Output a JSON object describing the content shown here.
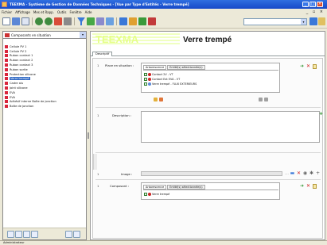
{
  "window": {
    "title": "TEEXMA - Système de Gestion de Données Techniques - [Vue par Type d'Entités - Verre trempé]",
    "controls": {
      "minimize": "_",
      "maximize": "□",
      "close": "×"
    },
    "colors": {
      "titlebar": "#1f5ad6",
      "close": "#d9482a"
    }
  },
  "menubar": {
    "items": [
      "Fichier",
      "Affichage",
      "Mes et Rapp.",
      "Outils",
      "Fenêtre",
      "Aide"
    ],
    "right_controls": "_ ▫ ×"
  },
  "toolbar": {
    "icons": [
      "new-icon",
      "save-icon",
      "print-icon",
      "back-icon",
      "forward-icon",
      "home-icon",
      "filter-icon",
      "text-icon",
      "chart-icon",
      "refresh-icon",
      "export-icon",
      "excel-icon",
      "delete-icon"
    ],
    "search_value": ""
  },
  "left_panel": {
    "combo_value": "Composants en situation",
    "items": [
      {
        "label": "Cellule PV 1",
        "selected": false
      },
      {
        "label": "Cellule PV 2",
        "selected": false
      },
      {
        "label": "Ruban contact 1",
        "selected": false
      },
      {
        "label": "Ruban contact 2",
        "selected": false
      },
      {
        "label": "Ruban contact 3",
        "selected": false
      },
      {
        "label": "Ruban sortie",
        "selected": false
      },
      {
        "label": "Protection silicone",
        "selected": false
      },
      {
        "label": "Verre trempé",
        "selected": true
      },
      {
        "label": "Cadre alu",
        "selected": false
      },
      {
        "label": "Joint silicone",
        "selected": false
      },
      {
        "label": "EVA",
        "selected": false
      },
      {
        "label": "EVA",
        "selected": false
      },
      {
        "label": "Adhésif interne Boîte de jonction",
        "selected": false
      },
      {
        "label": "Boîte de jonction",
        "selected": false
      }
    ],
    "bottom_icons": [
      "tree-view-icon",
      "list-view-icon",
      "search-view-icon",
      "sort-icon",
      "expand-icon",
      "collapse-icon"
    ]
  },
  "main": {
    "watermark": "TEEXMA",
    "page_title": "Verre trempé",
    "tab": "Descriptif",
    "fields": {
      "position": {
        "num": "1",
        "label": "Place en situation :",
        "colon": ":",
        "subtabs": [
          "Arborescence",
          "Entité(s) sélectionnée(s)"
        ],
        "tree": [
          {
            "label": "Contact 2V - VT"
          },
          {
            "label": "Contact Ext EVA - VT"
          },
          {
            "label": "Verre trempé - FLUX EXTERIEURS"
          }
        ]
      },
      "description": {
        "num": "1",
        "label": "Description :",
        "value": ""
      },
      "image": {
        "num": "1",
        "label": "Image :",
        "value": ""
      },
      "component": {
        "num": "1",
        "label": "Composant :",
        "subtabs": [
          "Arborescence",
          "Entité(s) sélectionnée(s)"
        ],
        "tree": [
          {
            "label": "Verre trempé"
          }
        ]
      }
    }
  },
  "statusbar": {
    "text": "Administrateur"
  }
}
